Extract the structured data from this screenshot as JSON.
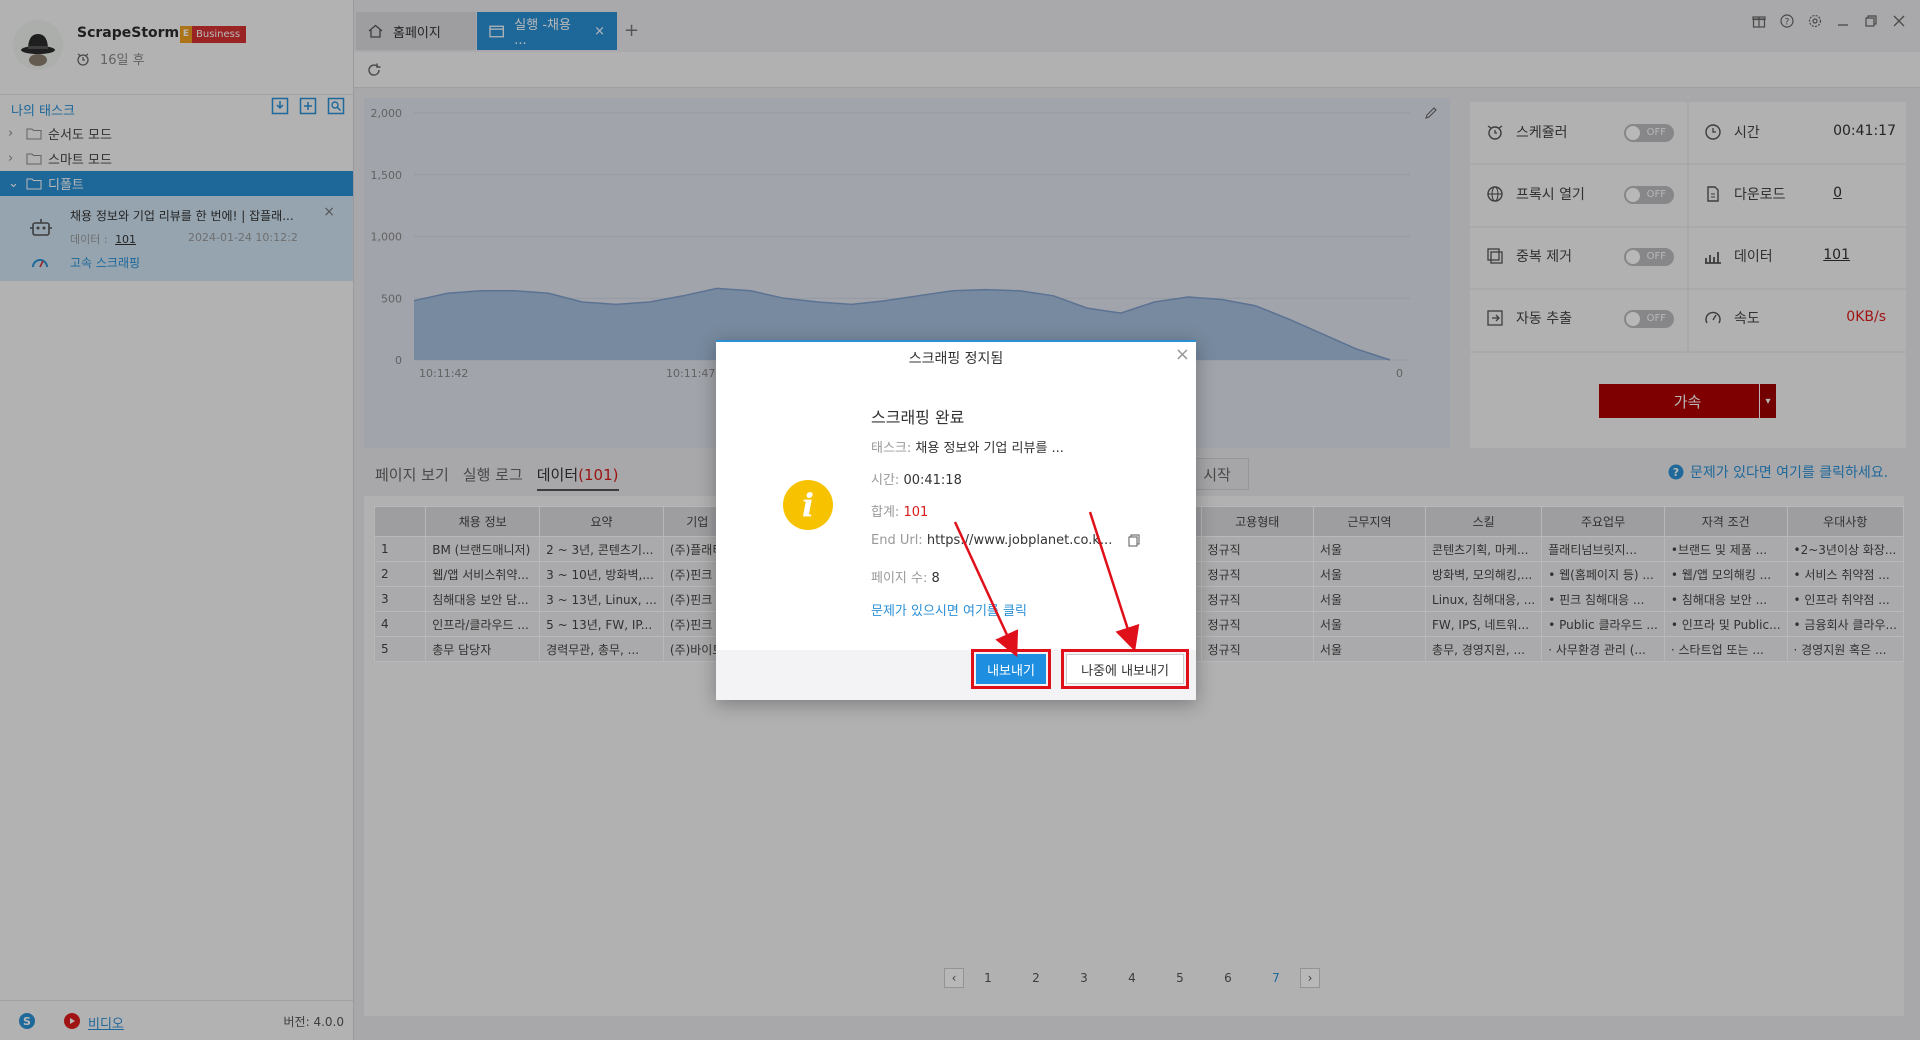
{
  "sidebar": {
    "app_name": "ScrapeStorm",
    "badge_letter": "E",
    "badge": "Business",
    "expire": "16일 후",
    "section_title": "나의 태스크",
    "items": [
      {
        "label": "순서도 모드"
      },
      {
        "label": "스마트 모드"
      },
      {
        "label": "디폴트"
      }
    ],
    "task": {
      "title": "채용 정보와 기업 리뷰를 한 번에! | 잡플래...",
      "data_label": "데이터 :",
      "data_count": "101",
      "date": "2024-01-24 10:12:2",
      "mode": "고속 스크래핑"
    },
    "footer": {
      "video": "비디오",
      "version": "버전: 4.0.0"
    }
  },
  "tabs": {
    "home": "홈페이지",
    "active": "실행 -채용 ..."
  },
  "chart_data": {
    "type": "area",
    "x_ticks": [
      "10:11:42",
      "10:11:47"
    ],
    "right_tick": "0",
    "y_ticks": [
      "2,000",
      "1,500",
      "1,000",
      "500",
      "0"
    ],
    "ylim": [
      0,
      2000
    ],
    "values": [
      480,
      540,
      560,
      560,
      540,
      470,
      450,
      470,
      520,
      580,
      560,
      500,
      470,
      450,
      480,
      520,
      560,
      570,
      560,
      520,
      420,
      380,
      470,
      510,
      490,
      440,
      330,
      210,
      90,
      0
    ],
    "grid": true,
    "color": "#9db8db"
  },
  "stats": {
    "scheduler": {
      "label": "스케쥴러",
      "toggle": "OFF"
    },
    "time": {
      "label": "시간",
      "value": "00:41:17"
    },
    "proxy": {
      "label": "프록시 열기",
      "toggle": "OFF"
    },
    "download": {
      "label": "다운로드",
      "value": "0"
    },
    "dedup": {
      "label": "중복 제거",
      "toggle": "OFF"
    },
    "data": {
      "label": "데이터",
      "value": "101"
    },
    "auto_export": {
      "label": "자동 추출",
      "toggle": "OFF"
    },
    "speed": {
      "label": "속도",
      "value": "0KB/s"
    },
    "accelerate": "가속"
  },
  "data_tabs": {
    "page_view": "페이지 보기",
    "run_log": "실행 로그",
    "data": "데이터",
    "data_count": "(101)",
    "start": "시작",
    "help": "문제가 있다면 여기를 클릭하세요."
  },
  "table": {
    "headers": [
      "",
      "채용 정보",
      "요약",
      "기업",
      "",
      "",
      "",
      "",
      "고용형태",
      "근무지역",
      "스킬",
      "주요업무",
      "자격 조건",
      "우대사항"
    ],
    "rows": [
      [
        "1",
        "BM (브랜드매니저)",
        "2 ~ 3년, 콘텐츠기...",
        "(주)플래티",
        "",
        "",
        "",
        "",
        "정규직",
        "서울",
        "콘텐츠기획, 마케...",
        "플래티넘브릿지...",
        "•브랜드 및 제품 ...",
        "•2~3년이상 화장..."
      ],
      [
        "2",
        "웹/앱 서비스취약...",
        "3 ~ 10년, 방화벽,...",
        "(주)핀크",
        "",
        "",
        "",
        "",
        "정규직",
        "서울",
        "방화벽, 모의해킹,...",
        "• 웹(홈페이지 등) ...",
        "• 웹/앱 모의해킹 ...",
        "• 서비스 취약점 ..."
      ],
      [
        "3",
        "침해대응 보안 담...",
        "3 ~ 13년, Linux, ...",
        "(주)핀크",
        "",
        "",
        "",
        "",
        "정규직",
        "서울",
        "Linux, 침해대응, ...",
        "• 핀크 침해대응 ...",
        "• 침해대응 보안 ...",
        "• 인프라 취약점 ..."
      ],
      [
        "4",
        "인프라/클라우드 ...",
        "5 ~ 13년, FW, IP...",
        "(주)핀크",
        "",
        "",
        "",
        "",
        "정규직",
        "서울",
        "FW, IPS, 네트워...",
        "• Public 클라우드 ...",
        "• 인프라 및 Public...",
        "• 금융회사 클라우..."
      ],
      [
        "5",
        "총무 담당자",
        "경력무관, 총무, ...",
        "(주)바이트",
        "",
        "",
        "",
        "",
        "정규직",
        "서울",
        "총무, 경영지원, ...",
        "· 사무환경 관리 (...",
        "· 스타트업 또는 ...",
        "· 경영지원 혹은 ..."
      ]
    ]
  },
  "pager": {
    "pages": [
      "1",
      "2",
      "3",
      "4",
      "5",
      "6",
      "7"
    ],
    "current": "7"
  },
  "dialog": {
    "title": "스크래핑 정지됨",
    "heading": "스크래핑 완료",
    "task_label": "태스크:",
    "task_value": "채용 정보와 기업 리뷰를 ...",
    "time_label": "시간:",
    "time_value": "00:41:18",
    "total_label": "합계:",
    "total_value": "101",
    "url_label": "End Url:",
    "url_value": "https://www.jobplanet.co.k...",
    "pages_label": "페이지 수:",
    "pages_value": "8",
    "help_link": "문제가 있으시면 여기를 클릭",
    "export_button": "내보내기",
    "export_later_button": "나중에 내보내기"
  }
}
